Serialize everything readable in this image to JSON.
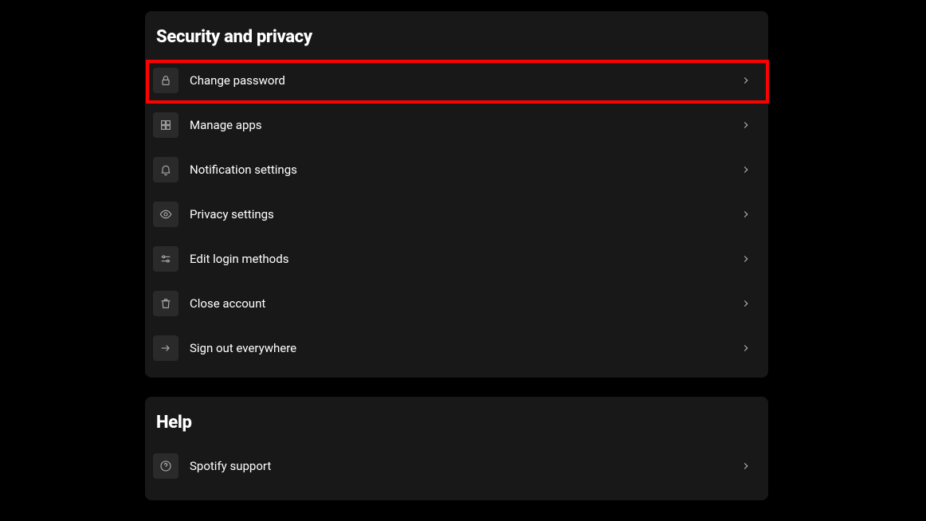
{
  "security": {
    "title": "Security and privacy",
    "items": [
      {
        "label": "Change password",
        "icon": "lock-icon",
        "highlight": true
      },
      {
        "label": "Manage apps",
        "icon": "apps-icon"
      },
      {
        "label": "Notification settings",
        "icon": "bell-icon"
      },
      {
        "label": "Privacy settings",
        "icon": "eye-icon"
      },
      {
        "label": "Edit login methods",
        "icon": "sliders-icon"
      },
      {
        "label": "Close account",
        "icon": "trash-icon"
      },
      {
        "label": "Sign out everywhere",
        "icon": "arrow-right-icon"
      }
    ]
  },
  "help": {
    "title": "Help",
    "items": [
      {
        "label": "Spotify support",
        "icon": "question-icon"
      }
    ]
  },
  "highlight_color": "#ff0000"
}
